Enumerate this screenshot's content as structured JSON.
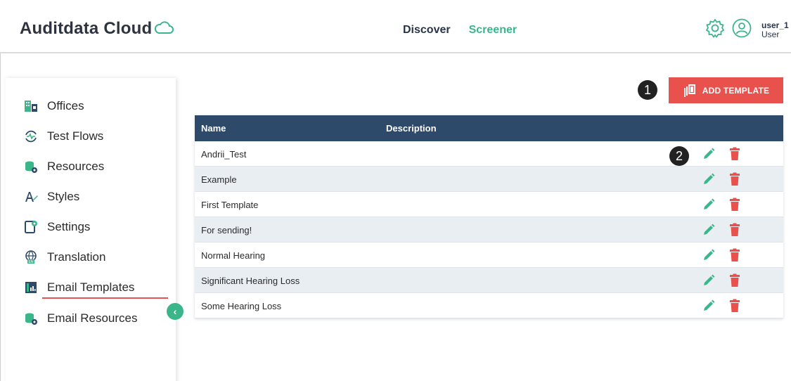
{
  "header": {
    "brand": "Auditdata Cloud",
    "nav": {
      "discover": "Discover",
      "screener": "Screener"
    },
    "user": {
      "name": "user_1",
      "role": "User"
    },
    "icons": [
      "cloud-icon",
      "gear-icon",
      "user-circle-icon"
    ]
  },
  "sidebar": {
    "items": [
      {
        "label": "Offices",
        "icon": "offices-icon"
      },
      {
        "label": "Test Flows",
        "icon": "test-flows-icon"
      },
      {
        "label": "Resources",
        "icon": "resources-icon"
      },
      {
        "label": "Styles",
        "icon": "styles-icon"
      },
      {
        "label": "Settings",
        "icon": "settings-icon"
      },
      {
        "label": "Translation",
        "icon": "translation-icon"
      },
      {
        "label": "Email Templates",
        "icon": "email-templates-icon",
        "active": true
      },
      {
        "label": "Email Resources",
        "icon": "email-resources-icon"
      }
    ],
    "collapse_icon": "chevron-left-icon"
  },
  "markers": {
    "one": "1",
    "two": "2"
  },
  "toolbar": {
    "add_label": "ADD TEMPLATE"
  },
  "table": {
    "columns": {
      "name": "Name",
      "description": "Description"
    },
    "rows": [
      {
        "name": "Andrii_Test",
        "description": ""
      },
      {
        "name": "Example",
        "description": ""
      },
      {
        "name": "First Template",
        "description": ""
      },
      {
        "name": "For sending!",
        "description": ""
      },
      {
        "name": "Normal Hearing",
        "description": ""
      },
      {
        "name": "Significant Hearing Loss",
        "description": ""
      },
      {
        "name": "Some Hearing Loss",
        "description": ""
      }
    ]
  },
  "colors": {
    "accent_green": "#3bb58a",
    "accent_red": "#e9514d",
    "table_header": "#2e4a6b",
    "row_alt": "#e9eef2"
  }
}
